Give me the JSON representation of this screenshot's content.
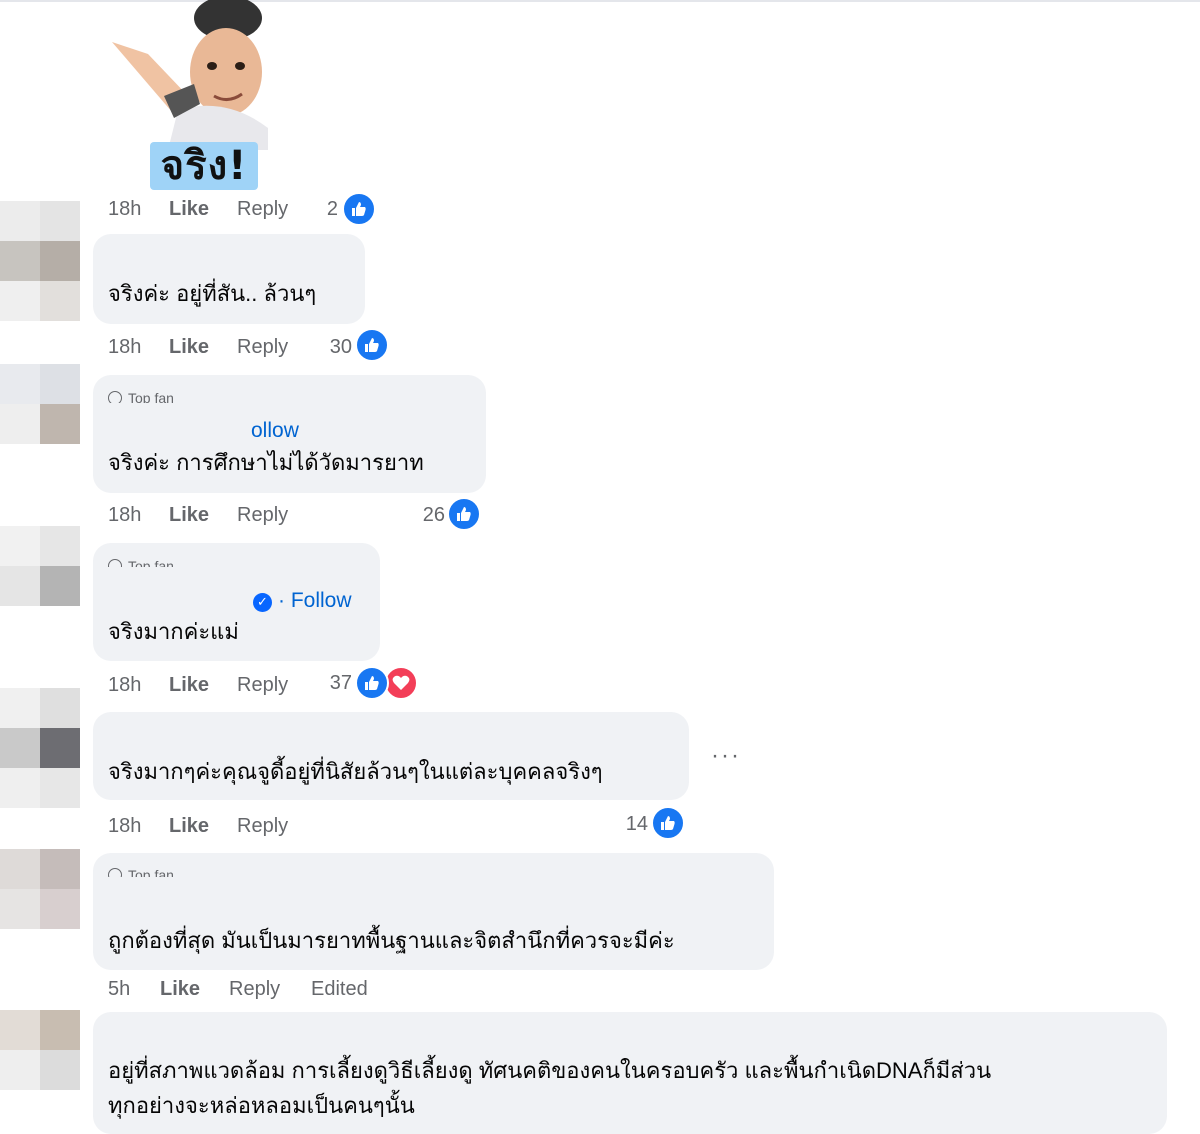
{
  "sticker": {
    "caption": "จริง!"
  },
  "comments": [
    {
      "time": "18h",
      "like": "Like",
      "reply": "Reply",
      "count": "2"
    },
    {
      "text": "จริงค่ะ อยู่ที่สัน.. ล้วนๆ",
      "time": "18h",
      "like": "Like",
      "reply": "Reply",
      "count": "30"
    },
    {
      "badge": "Top fan",
      "follow": "ollow",
      "text": "จริงค่ะ การศึกษาไม่ได้วัดมารยาท",
      "time": "18h",
      "like": "Like",
      "reply": "Reply",
      "count": "26"
    },
    {
      "badge": "Top fan",
      "follow": "· Follow",
      "text": "จริงมากค่ะแม่",
      "time": "18h",
      "like": "Like",
      "reply": "Reply",
      "count": "37"
    },
    {
      "text": "จริงมากๆค่ะคุณจูดี้อยู่ที่นิสัยล้วนๆในแต่ละบุคคลจริงๆ",
      "more": "···",
      "time": "18h",
      "like": "Like",
      "reply": "Reply",
      "count": "14"
    },
    {
      "badge": "Top fan",
      "text": "ถูกต้องที่สุด มันเป็นมารยาทพื้นฐานและจิตสำนึกที่ควรจะมีค่ะ",
      "time": "5h",
      "like": "Like",
      "reply": "Reply",
      "edited": "Edited"
    },
    {
      "text_line1": "อยู่ที่สภาพแวดล้อม การเลี้ยงดูวิธีเลี้ยงดู ทัศนคติของคนในครอบครัว และพื้นกำเนิดDNAก็มีส่วน",
      "text_line2": "ทุกอย่างจะหล่อหลอมเป็นคนๆนั้น"
    }
  ],
  "colors": {
    "bubble": "#f0f2f5",
    "meta": "#65676b",
    "link": "#0064d1",
    "like": "#1877f2",
    "love": "#f33e58"
  },
  "icons": [
    "like-reaction-icon",
    "love-reaction-icon",
    "verified-icon",
    "globe-icon",
    "more-options-icon"
  ]
}
